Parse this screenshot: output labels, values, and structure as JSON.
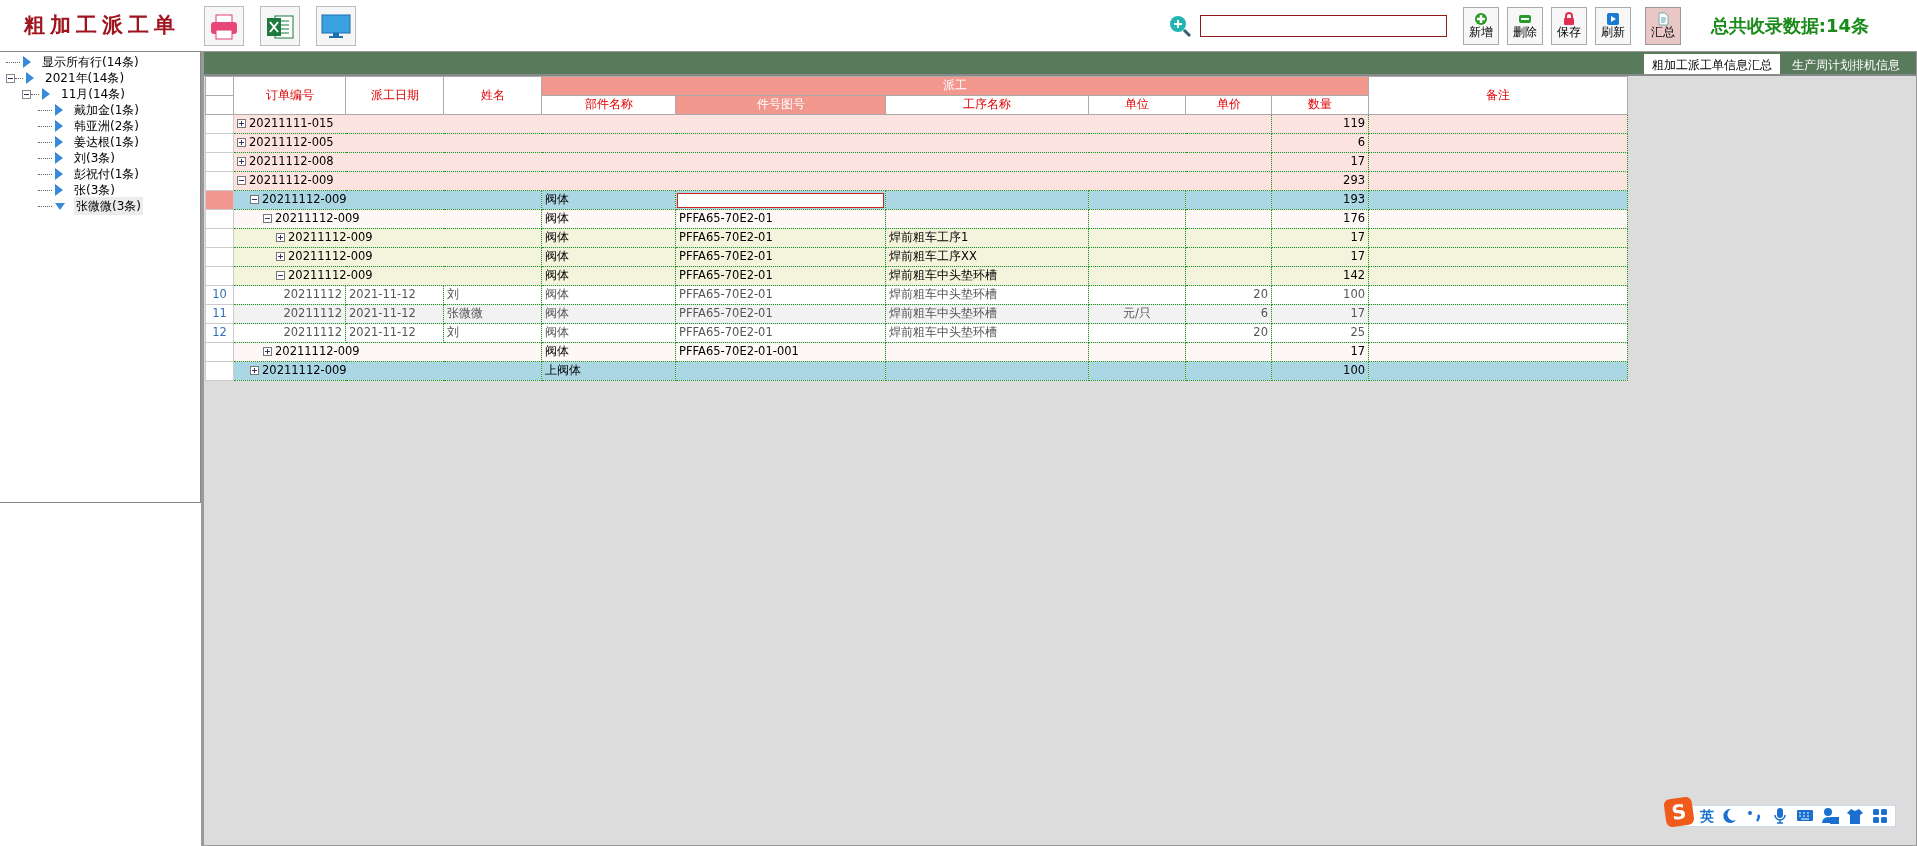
{
  "window": {
    "title": "粗加工派工单"
  },
  "toolbar": {
    "left_buttons": [
      {
        "kind": "print"
      },
      {
        "kind": "excel"
      },
      {
        "kind": "screen"
      }
    ],
    "buttons": [
      {
        "kind": "add",
        "label": "新增",
        "pressed": false
      },
      {
        "kind": "delete",
        "label": "删除",
        "pressed": false
      },
      {
        "kind": "save",
        "label": "保存",
        "pressed": false
      },
      {
        "kind": "refresh",
        "label": "刷新",
        "pressed": false
      },
      {
        "kind": "summary",
        "label": "汇总",
        "pressed": true
      }
    ],
    "total": "总共收录数据:14条"
  },
  "tree": [
    {
      "label": "显示所有行(14条)",
      "selected": false
    },
    {
      "label": "2021年(14条)",
      "selected": false,
      "expanded": true,
      "children": [
        {
          "label": "11月(14条)",
          "selected": false,
          "expanded": true,
          "children": [
            {
              "label": "戴加金(1条)",
              "selected": false
            },
            {
              "label": "韩亚洲(2条)",
              "selected": false
            },
            {
              "label": "姜达根(1条)",
              "selected": false
            },
            {
              "label": "刘(3条)",
              "selected": false
            },
            {
              "label": "彭祝付(1条)",
              "selected": false
            },
            {
              "label": "张(3条)",
              "selected": false
            },
            {
              "label": "张微微(3条)",
              "selected": true
            }
          ]
        }
      ]
    }
  ],
  "tabs": [
    {
      "label": "粗加工派工单信息汇总",
      "selected": true
    },
    {
      "label": "生产周计划排机信息",
      "selected": false
    }
  ],
  "table": {
    "column_group": "派工",
    "columns": [
      {
        "label": "订单编号",
        "selected": false
      },
      {
        "label": "派工日期",
        "selected": false
      },
      {
        "label": "姓名",
        "selected": false
      },
      {
        "label": "部件名称",
        "selected": false
      },
      {
        "label": "件号图号",
        "selected": true
      },
      {
        "label": "工序名称",
        "selected": false
      },
      {
        "label": "单位",
        "selected": false
      },
      {
        "label": "单价",
        "selected": false
      },
      {
        "label": "数量",
        "selected": false
      },
      {
        "label": "备注",
        "selected": false
      }
    ],
    "rows": [
      {
        "kind": "group",
        "order": "20211111-015",
        "quantity": "119",
        "expanded": false,
        "selected": false
      },
      {
        "kind": "group",
        "order": "20211112-005",
        "quantity": "6",
        "expanded": false,
        "selected": false
      },
      {
        "kind": "group",
        "order": "20211112-008",
        "quantity": "17",
        "expanded": false,
        "selected": false
      },
      {
        "kind": "group",
        "order": "20211112-009",
        "quantity": "293",
        "expanded": true,
        "selected": false,
        "children": [
          {
            "kind": "group",
            "order": "20211112-009",
            "part": "阀体",
            "quantity": "193",
            "expanded": true,
            "selected": true,
            "children": [
              {
                "kind": "group",
                "order": "20211112-009",
                "part": "阀体",
                "drawing": "PFFA65-70E2-01",
                "quantity": "176",
                "expanded": true,
                "selected": false,
                "children": [
                  {
                    "kind": "group",
                    "order": "20211112-009",
                    "part": "阀体",
                    "drawing": "PFFA65-70E2-01",
                    "process": "焊前粗车工序1",
                    "quantity": "17",
                    "expanded": false,
                    "selected": false
                  },
                  {
                    "kind": "group",
                    "order": "20211112-009",
                    "part": "阀体",
                    "drawing": "PFFA65-70E2-01",
                    "process": "焊前粗车工序XX",
                    "quantity": "17",
                    "expanded": false,
                    "selected": false
                  },
                  {
                    "kind": "group",
                    "order": "20211112-009",
                    "part": "阀体",
                    "drawing": "PFFA65-70E2-01",
                    "process": "焊前粗车中头垫环槽",
                    "quantity": "142",
                    "expanded": true,
                    "selected": false,
                    "children": [
                      {
                        "kind": "detail",
                        "row_number": "10",
                        "order": "20211112",
                        "date": "2021-11-12",
                        "name": "刘",
                        "part": "阀体",
                        "drawing": "PFFA65-70E2-01",
                        "process": "焊前粗车中头垫环槽",
                        "price": "20",
                        "quantity": "100",
                        "selected": false
                      },
                      {
                        "kind": "detail",
                        "row_number": "11",
                        "order": "20211112",
                        "date": "2021-11-12",
                        "name": "张微微",
                        "part": "阀体",
                        "drawing": "PFFA65-70E2-01",
                        "process": "焊前粗车中头垫环槽",
                        "unit": "元/只",
                        "price": "6",
                        "quantity": "17",
                        "selected": false
                      },
                      {
                        "kind": "detail",
                        "row_number": "12",
                        "order": "20211112",
                        "date": "2021-11-12",
                        "name": "刘",
                        "part": "阀体",
                        "drawing": "PFFA65-70E2-01",
                        "process": "焊前粗车中头垫环槽",
                        "price": "20",
                        "quantity": "25",
                        "selected": false
                      }
                    ]
                  }
                ]
              },
              {
                "kind": "group",
                "order": "20211112-009",
                "part": "阀体",
                "drawing": "PFFA65-70E2-01-001",
                "quantity": "17",
                "expanded": false,
                "selected": false
              }
            ]
          },
          {
            "kind": "group",
            "order": "20211112-009",
            "part": "上阀体",
            "quantity": "100",
            "expanded": false,
            "selected": false
          }
        ]
      }
    ]
  },
  "ime_bar": {
    "logo": "S",
    "mode": "英"
  }
}
